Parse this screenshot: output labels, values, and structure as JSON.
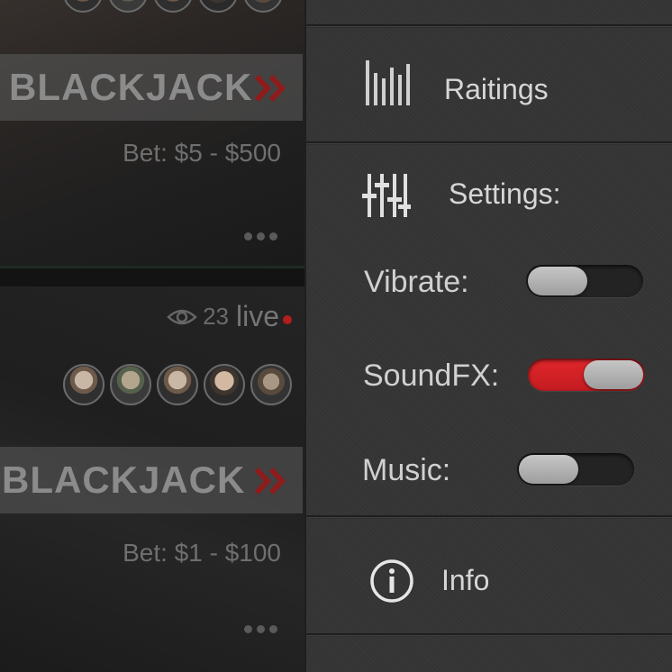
{
  "lobby": {
    "tables": [
      {
        "game": "BLACKJACK",
        "bet": "Bet: $5 - $500"
      },
      {
        "game": "BLACKJACK",
        "bet": "Bet: $1 - $100",
        "viewers": "23",
        "live_label": "live"
      }
    ],
    "colors": {
      "accent": "#b31d1d"
    }
  },
  "drawer": {
    "ratings": {
      "label": "Raitings",
      "icon": "bars-chart-icon"
    },
    "settings": {
      "label": "Settings:",
      "icon": "sliders-icon",
      "toggles": [
        {
          "label": "Vibrate:",
          "on": false
        },
        {
          "label": "SoundFX:",
          "on": true
        },
        {
          "label": "Music:",
          "on": false
        }
      ]
    },
    "info": {
      "label": "Info",
      "icon": "info-circle-icon"
    },
    "colors": {
      "toggle_on": "#e0262b",
      "background": "#353535",
      "text": "#d6d6d6"
    }
  }
}
